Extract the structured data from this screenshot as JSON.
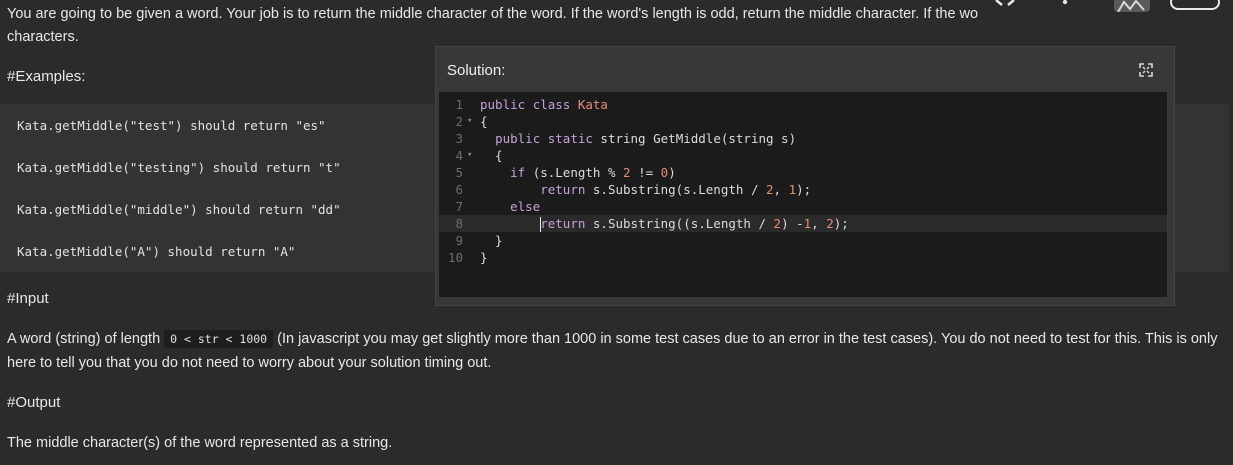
{
  "description": {
    "line1": "You are going to be given a word. Your job is to return the middle character of the word. If the word's length is odd, return the middle character. If the wo",
    "line2": "characters."
  },
  "examples": {
    "heading": "#Examples:",
    "lines": [
      "Kata.getMiddle(\"test\") should return \"es\"",
      "Kata.getMiddle(\"testing\") should return \"t\"",
      "Kata.getMiddle(\"middle\") should return \"dd\"",
      "Kata.getMiddle(\"A\") should return \"A\""
    ]
  },
  "solution_panel": {
    "title": "Solution:",
    "expand_icon": "expand-icon",
    "code_lines": [
      {
        "num": "1",
        "text": "public class Kata"
      },
      {
        "num": "2",
        "text": "{"
      },
      {
        "num": "3",
        "text": "  public static string GetMiddle(string s)"
      },
      {
        "num": "4",
        "text": "  {"
      },
      {
        "num": "5",
        "text": "    if (s.Length % 2 != 0)"
      },
      {
        "num": "6",
        "text": "        return s.Substring(s.Length / 2, 1);"
      },
      {
        "num": "7",
        "text": "    else"
      },
      {
        "num": "8",
        "text": "        return s.Substring((s.Length / 2) -1, 2);"
      },
      {
        "num": "9",
        "text": "  }"
      },
      {
        "num": "10",
        "text": "}"
      }
    ]
  },
  "input_section": {
    "heading": "#Input",
    "text_before": "A word (string) of length",
    "code": "0 < str < 1000",
    "text_after": "(In javascript you may get slightly more than 1000 in some test cases due to an error in the test cases). You do not need to test for this. This is only",
    "line2": "here to tell you that you do not need to worry about your solution timing out."
  },
  "output_section": {
    "heading": "#Output",
    "text": "The middle character(s) of the word represented as a string."
  },
  "colors": {
    "background": "#2b2b2b",
    "editor_background": "#1b1b1b",
    "keyword": "#c4a1d9",
    "literal": "#e58c78"
  }
}
